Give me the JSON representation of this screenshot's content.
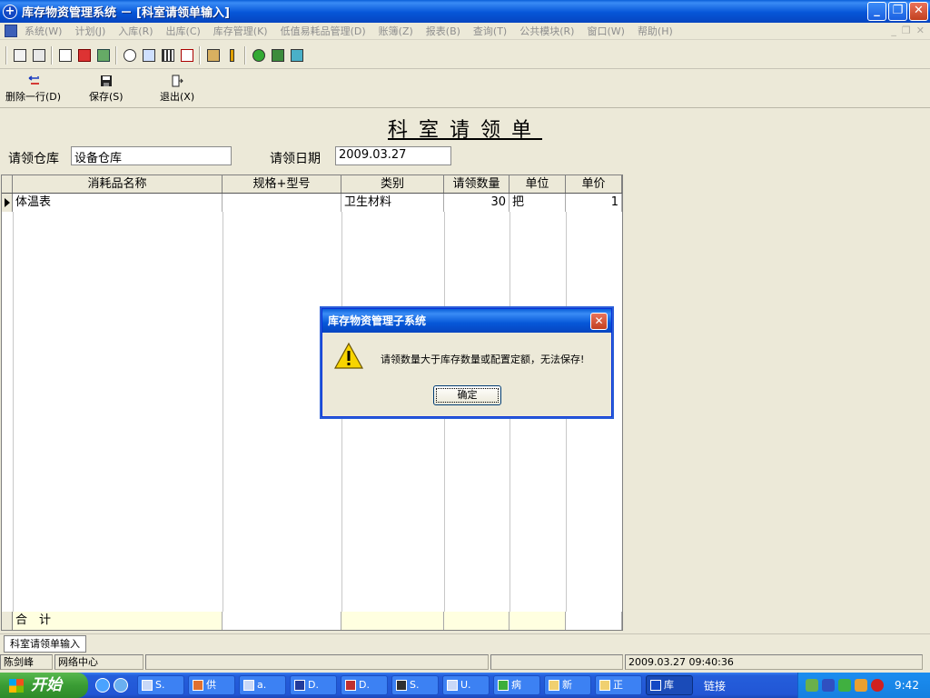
{
  "window": {
    "title": "库存物资管理系统 － [科室请领单输入]",
    "min": "_",
    "restore": "❐",
    "close": "✕"
  },
  "menu": [
    "系统(W)",
    "计划(J)",
    "入库(R)",
    "出库(C)",
    "库存管理(K)",
    "低值易耗品管理(D)",
    "账簿(Z)",
    "报表(B)",
    "查询(T)",
    "公共模块(R)",
    "窗口(W)",
    "帮助(H)"
  ],
  "mdi": {
    "min": "_",
    "restore": "❐",
    "close": "✕"
  },
  "toolbar_icons": [
    "exit-icon",
    "edit-icon",
    "doc-icon",
    "copy-icon",
    "recycle-icon",
    "search-icon",
    "form-icon",
    "grid-icon",
    "print-preview-icon",
    "printer-icon",
    "thermometer-icon",
    "minus-icon",
    "book-icon",
    "calculator-icon"
  ],
  "actions": [
    {
      "label": "删除一行(D)",
      "icon": "delete-row-icon"
    },
    {
      "label": "保存(S)",
      "icon": "save-icon"
    },
    {
      "label": "退出(X)",
      "icon": "exit-icon"
    }
  ],
  "form": {
    "title": "科室请领单",
    "warehouse_label": "请领仓库",
    "warehouse_value": "设备仓库",
    "date_label": "请领日期",
    "date_value": "2009.03.27"
  },
  "grid": {
    "columns": [
      "消耗品名称",
      "规格+型号",
      "类别",
      "请领数量",
      "单位",
      "单价"
    ],
    "rows": [
      {
        "name": "体温表",
        "spec": "",
        "category": "卫生材料",
        "qty": "30",
        "unit": "把",
        "price": "1"
      }
    ],
    "total_label": "合　计"
  },
  "dialog": {
    "title": "库存物资管理子系统",
    "message": "请领数量大于库存数量或配置定额，无法保存!",
    "ok": "确定",
    "icon": "warning-icon"
  },
  "tab": "科室请领单输入",
  "status": {
    "user": "陈剑峰",
    "dept": "网络中心",
    "datetime": "2009.03.27 09:40:36"
  },
  "taskbar": {
    "start": "开始",
    "tasks": [
      "S.",
      "供",
      "a.",
      "D.",
      "D.",
      "S.",
      "U.",
      "病",
      "新",
      "正",
      "库"
    ],
    "active_task": 10,
    "links": "链接",
    "clock": "9:42"
  },
  "colors": {
    "title_blue": "#0656d8",
    "form_bg": "#ece9d8",
    "total_row": "#ffffe0"
  }
}
